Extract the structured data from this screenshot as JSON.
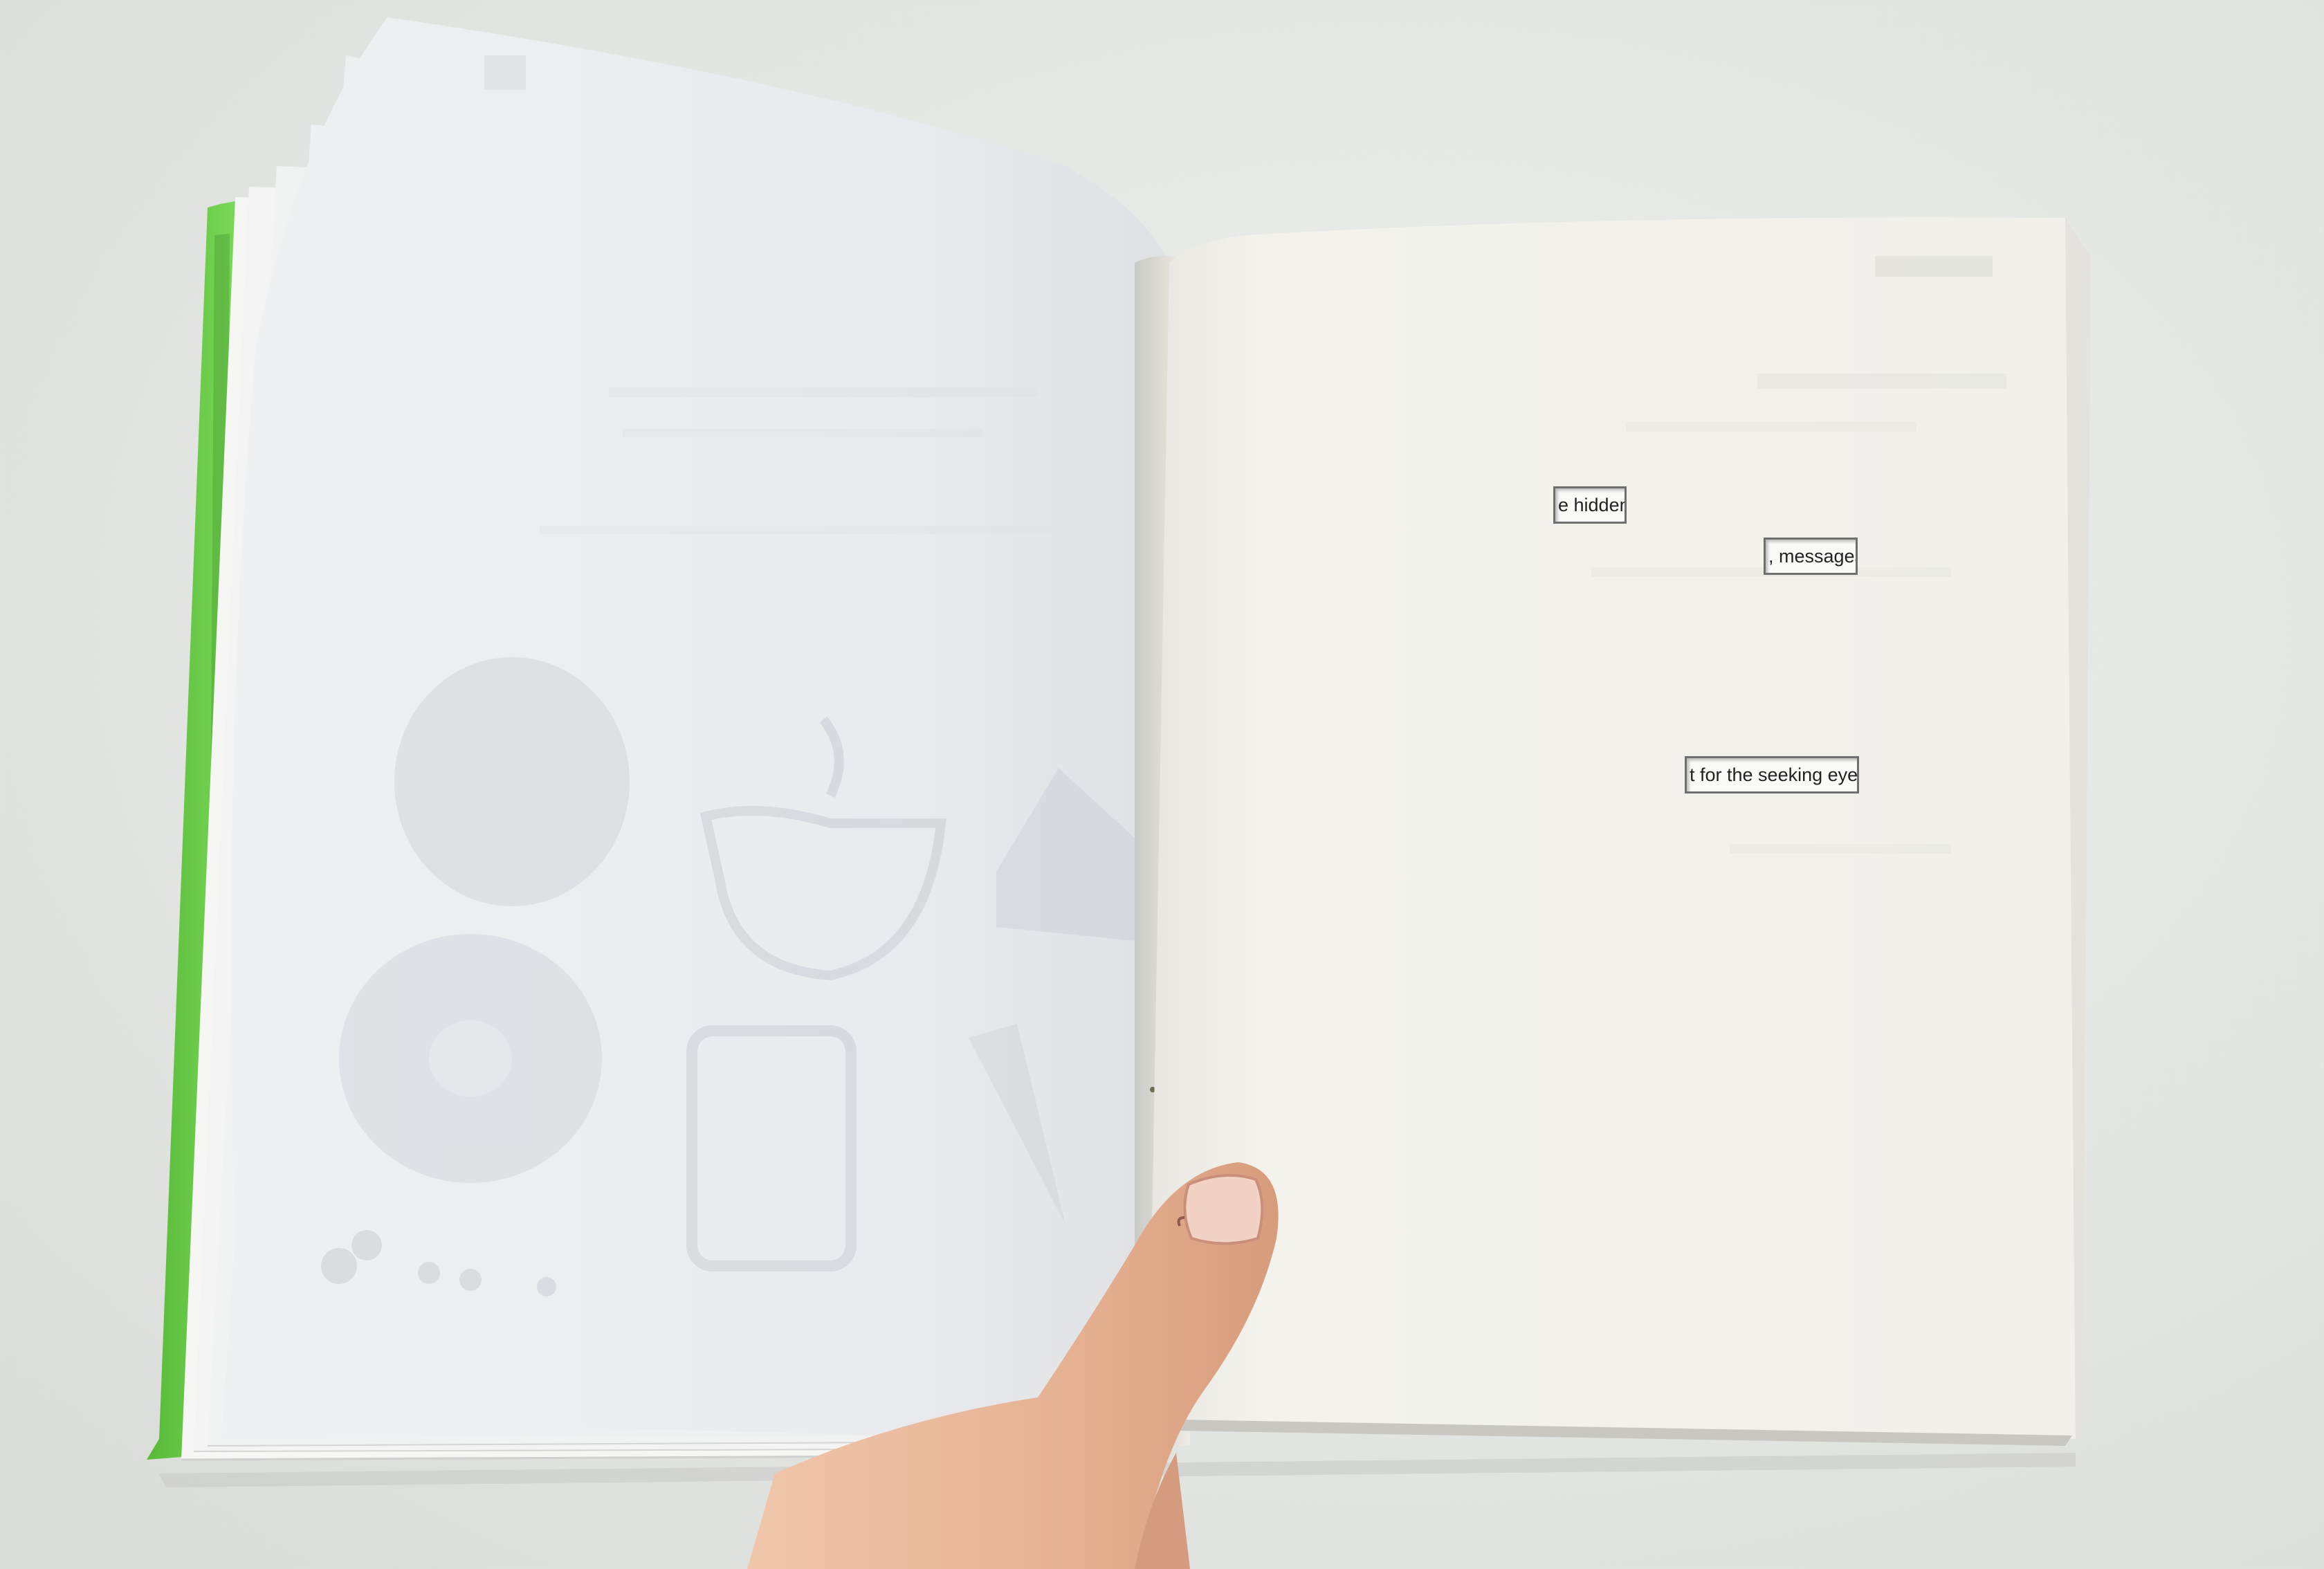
{
  "photo": {
    "subject": "open-book-with-cutout-page",
    "colors": {
      "background": "#e5e7e4",
      "page": "#f2f1ec",
      "page_shadow": "#dcdcd6",
      "spine_green": "#6fd14a",
      "skin": "#e7b597"
    }
  },
  "cutouts": [
    {
      "text": "e hidden"
    },
    {
      "text": ", messages"
    },
    {
      "text": "t for the seeking eye."
    }
  ]
}
